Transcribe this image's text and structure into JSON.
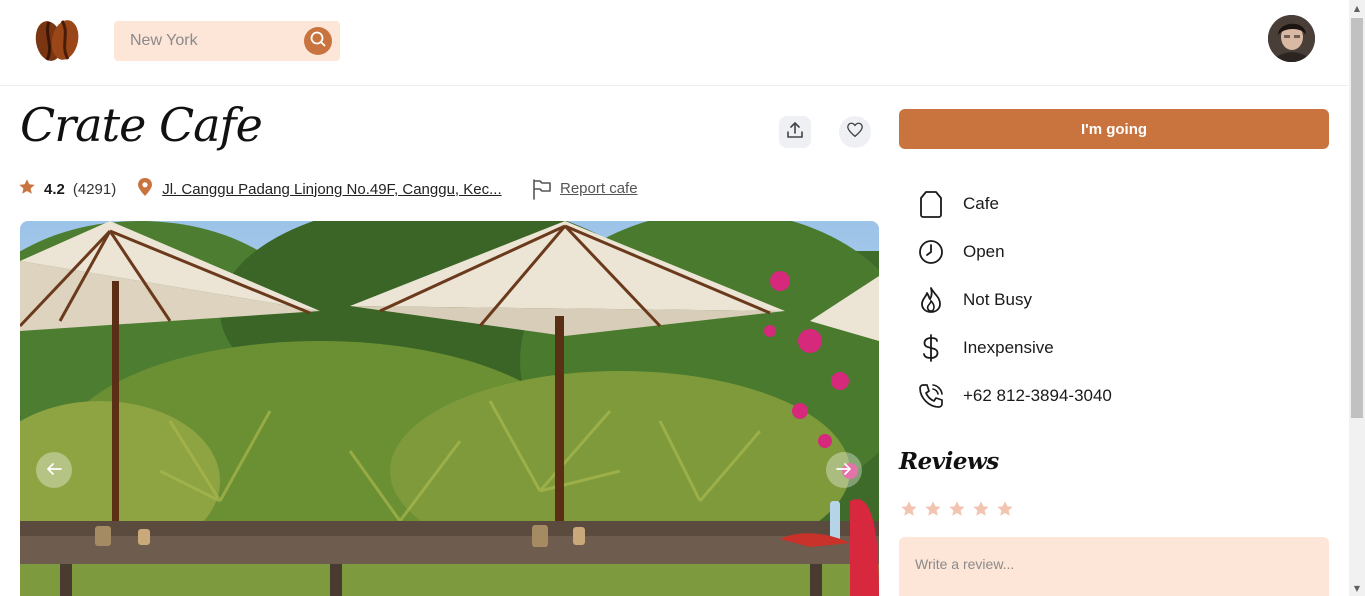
{
  "header": {
    "search_placeholder": "New York"
  },
  "cafe": {
    "name": "Crate Cafe",
    "rating": "4.2",
    "review_count": "(4291)",
    "address": "Jl. Canggu Padang Linjong No.49F, Canggu, Kec...",
    "report_label": "Report cafe"
  },
  "panel": {
    "going_label": "I'm going",
    "info": [
      {
        "icon": "tag-icon",
        "label": "Cafe"
      },
      {
        "icon": "clock-icon",
        "label": "Open"
      },
      {
        "icon": "flame-icon",
        "label": "Not Busy"
      },
      {
        "icon": "dollar-icon",
        "label": "Inexpensive"
      },
      {
        "icon": "phone-icon",
        "label": "+62 812-3894-3040"
      }
    ],
    "reviews_title": "Reviews",
    "review_stars": 0,
    "review_placeholder": "Write a review..."
  },
  "colors": {
    "accent": "#c9743f",
    "accent_light": "#fde5d8",
    "star_empty": "#f2c4b1"
  }
}
